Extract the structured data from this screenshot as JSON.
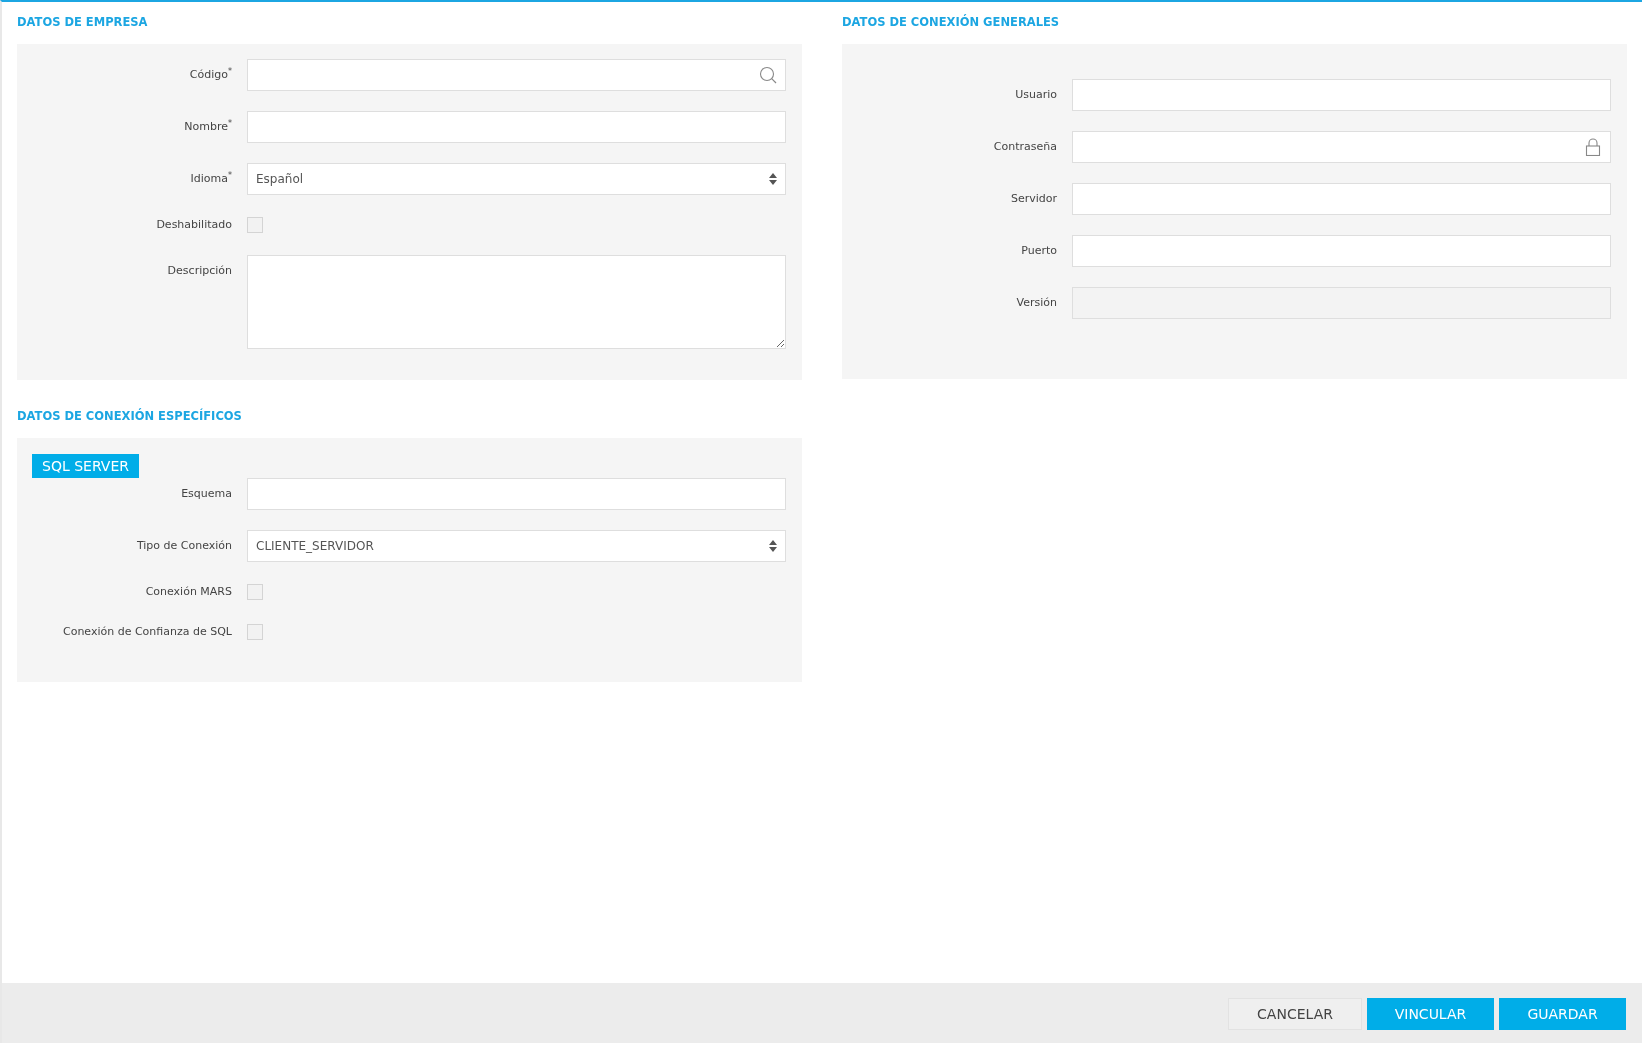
{
  "left_column": [
    {
      "title": "DATOS DE EMPRESA",
      "fields": [
        {
          "kind": "search",
          "label": "Código$^{*}$"
        },
        {
          "kind": "text",
          "label": "Nombre$^{*}$"
        },
        {
          "kind": "select",
          "label": "Idioma$^{*}$",
          "value": "Español"
        },
        {
          "kind": "checkbox",
          "label": "Deshabilitado",
          "checked": false
        },
        {
          "kind": "textarea",
          "label": "Descripción"
        }
      ]
    },
    {
      "title": "DATOS DE CONEXIÓN ESPECÍFICOS",
      "tag": "SQL SERVER",
      "fields": [
        {
          "kind": "text",
          "label": "Esquema"
        },
        {
          "kind": "select",
          "label": "Tipo de Conexión",
          "value": "CLIENTE_SERVIDOR"
        },
        {
          "kind": "checkbox",
          "label": "Conexión MARS",
          "checked": false
        },
        {
          "kind": "checkbox",
          "label": "Conexión de Confianza de SQL",
          "checked": false
        }
      ]
    }
  ],
  "right_column": [
    {
      "title": "DATOS DE CONEXIÓN GENERALES",
      "fields": [
        {
          "kind": "text",
          "label": "Usuario"
        },
        {
          "kind": "password",
          "label": "Contraseña"
        },
        {
          "kind": "text",
          "label": "Servidor"
        },
        {
          "kind": "text",
          "label": "Puerto"
        },
        {
          "kind": "readonly",
          "label": "Versión"
        }
      ]
    }
  ],
  "footer": {
    "buttons": [
      {
        "kind": "secondary",
        "label": "CANCELAR"
      },
      {
        "kind": "primary",
        "label": "VINCULAR"
      },
      {
        "kind": "primary",
        "label": "GUARDAR"
      }
    ]
  }
}
